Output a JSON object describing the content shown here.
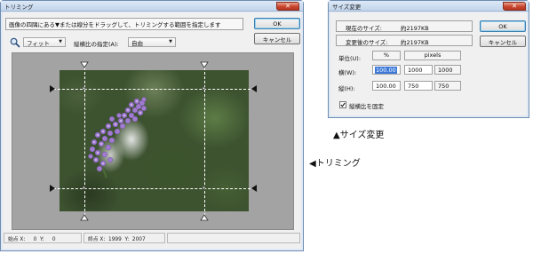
{
  "trim_window": {
    "title": "トリミング",
    "instruction": "画像の四隅にある▼または線分をドラッグして、トリミングする範囲を指定します",
    "ok_label": "OK",
    "cancel_label": "キャンセル",
    "zoom_select": "フィット",
    "aspect_label": "縦横比の指定(A):",
    "aspect_select": "自由",
    "status": {
      "start": "始点 X:     0  Y:     0",
      "end": "終点 X:  1999  Y:  2007"
    }
  },
  "resize_window": {
    "title": "サイズ変更",
    "current_size_label": "現在のサイズ:",
    "current_size_value": "約2197KB",
    "new_size_label": "変更後のサイズ:",
    "new_size_value": "約2197KB",
    "unit_label": "単位(U):",
    "unit_percent": "%",
    "unit_pixels": "pixels",
    "width_label": "横(W):",
    "width_percent": "100.00",
    "width_px": "1000",
    "width_orig": "1000",
    "height_label": "縦(H):",
    "height_percent": "100.00",
    "height_px": "750",
    "height_orig": "750",
    "keep_ratio_label": "縦横比を固定",
    "ok_label": "OK",
    "cancel_label": "キャンセル"
  },
  "captions": {
    "resize": "▲サイズ変更",
    "trim": "◀トリミング"
  },
  "colors": {
    "window_frame": "#dfe9f5",
    "close_button": "#c8462d",
    "canvas_gray": "#a3a3a3"
  },
  "icons": [
    "magnifier-icon",
    "close-icon",
    "dropdown-arrow-icon",
    "crop-handle-triangle-icon",
    "checkbox-checked-icon"
  ]
}
